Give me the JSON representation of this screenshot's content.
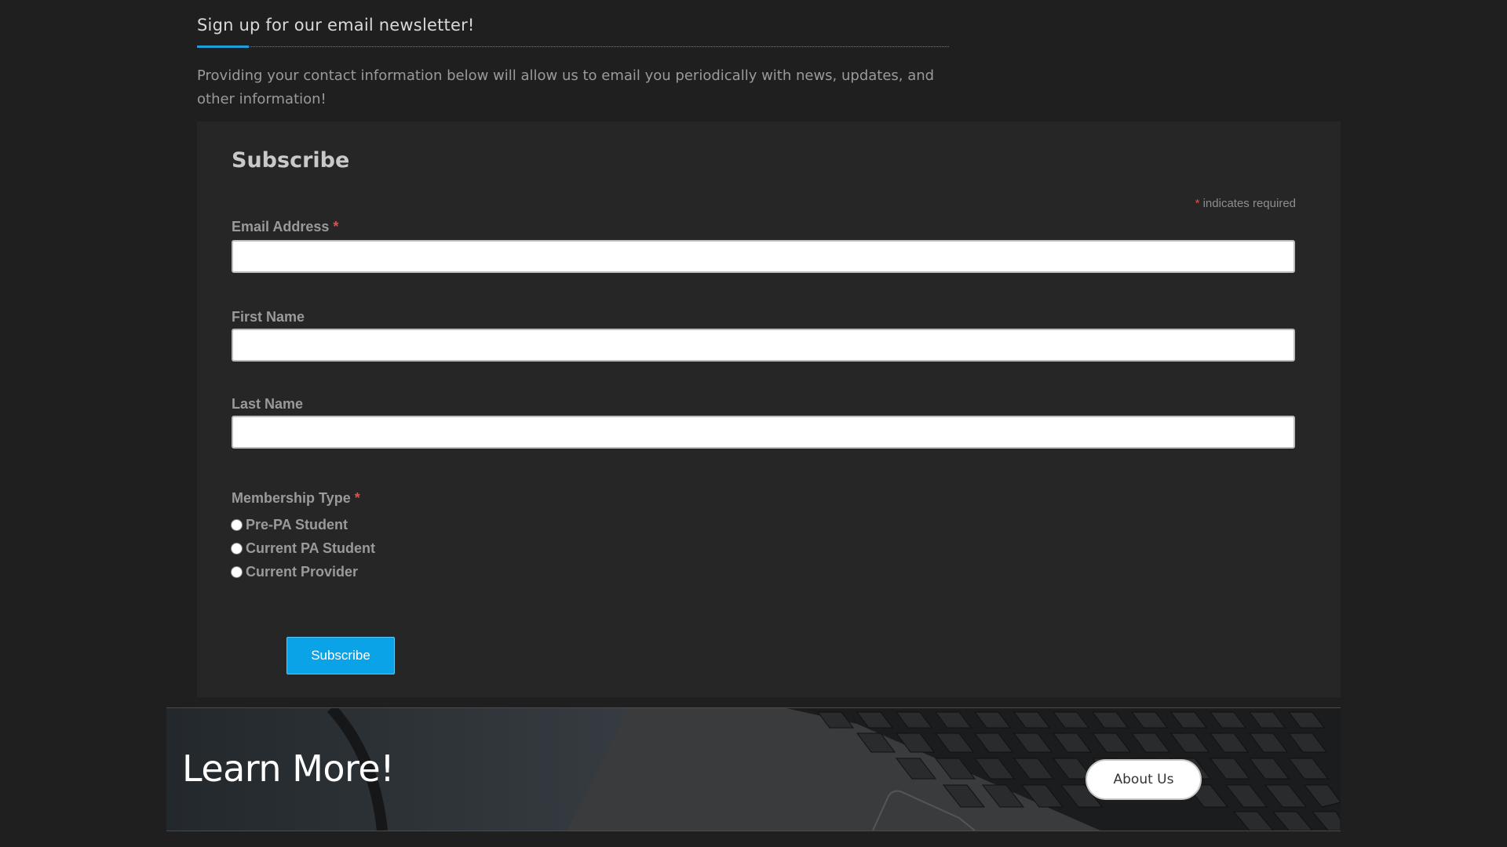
{
  "newsletter": {
    "heading": "Sign up for our email newsletter!",
    "description": "Providing your contact information below will allow us to email you periodically with news, updates, and other information!"
  },
  "form": {
    "title": "Subscribe",
    "required_marker": "*",
    "required_note": "indicates required",
    "fields": {
      "email": {
        "label": "Email Address",
        "value": "",
        "required": true
      },
      "first_name": {
        "label": "First Name",
        "value": ""
      },
      "last_name": {
        "label": "Last Name",
        "value": ""
      }
    },
    "membership": {
      "label": "Membership Type",
      "options": [
        {
          "label": "Pre-PA Student",
          "selected": false
        },
        {
          "label": "Current PA Student",
          "selected": false
        },
        {
          "label": "Current Provider",
          "selected": false
        }
      ]
    },
    "submit_label": "Subscribe"
  },
  "banner": {
    "title": "Learn More!",
    "button_label": "About Us"
  },
  "colors": {
    "accent": "#0aa3e8",
    "required": "#d9534f",
    "background": "#1f1f1f",
    "panel": "#262626"
  }
}
